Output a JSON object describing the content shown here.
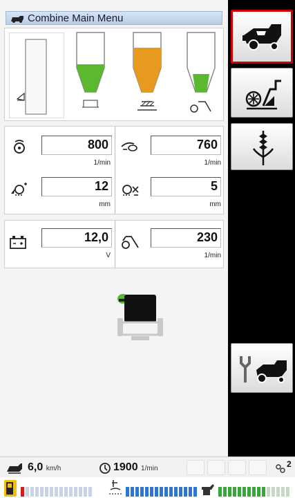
{
  "title": "Combine Main Menu",
  "params": [
    {
      "value": "800",
      "unit": "1/min",
      "icon": "drum-speed-icon"
    },
    {
      "value": "760",
      "unit": "1/min",
      "icon": "fan-speed-icon"
    },
    {
      "value": "12",
      "unit": "mm",
      "icon": "concave-gap-up-icon"
    },
    {
      "value": "5",
      "unit": "mm",
      "icon": "concave-gap-down-icon"
    },
    {
      "value": "12,0",
      "unit": "V",
      "icon": "battery-icon"
    },
    {
      "value": "230",
      "unit": "1/min",
      "icon": "chopper-speed-icon"
    }
  ],
  "bins": [
    {
      "name": "grain-tank",
      "fill": 0.45,
      "color": "#5cb82e"
    },
    {
      "name": "tailings",
      "fill": 0.75,
      "color": "#e89a1e"
    },
    {
      "name": "returns",
      "fill": 0.3,
      "color": "#5cb82e"
    }
  ],
  "status": {
    "speed_value": "6,0",
    "speed_unit": "km/h",
    "engine_value": "1900",
    "engine_unit": "1/min",
    "corner_label": "2"
  },
  "side_buttons": [
    "combine-overview",
    "threshing-settings",
    "crop-settings",
    "service"
  ],
  "colors": {
    "active_border": "#d10000",
    "grain": "#5cb82e",
    "tailings": "#e89a1e",
    "gauge_blue": "#2f74d0",
    "gauge_red": "#d01c1c",
    "gauge_green": "#3aa63a"
  }
}
